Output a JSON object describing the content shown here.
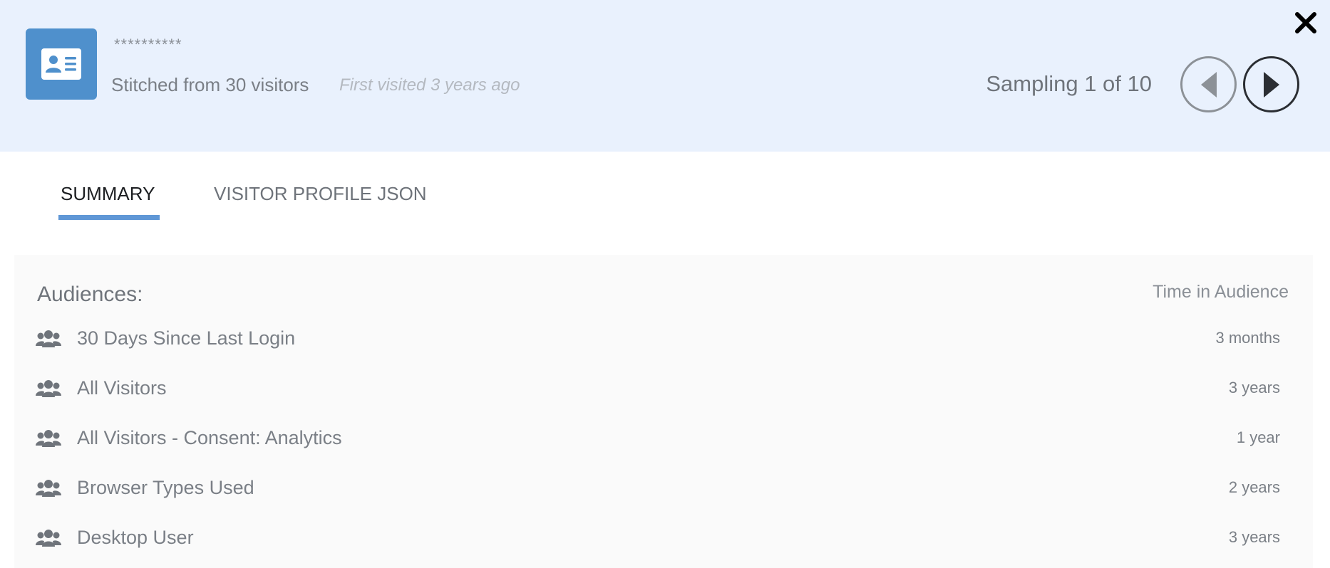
{
  "header": {
    "visitor_id": "**********",
    "stitched_text": "Stitched from 30 visitors",
    "first_visited_text": "First visited 3 years ago",
    "sampling_text": "Sampling 1 of 10",
    "icons": {
      "avatar": "id-card-icon",
      "prev": "triangle-left-icon",
      "next": "triangle-right-icon",
      "close": "close-icon"
    }
  },
  "tabs": [
    {
      "label": "SUMMARY",
      "active": true
    },
    {
      "label": "VISITOR PROFILE JSON",
      "active": false
    }
  ],
  "audiences": {
    "title": "Audiences:",
    "time_header": "Time in Audience",
    "icon": "group-icon",
    "items": [
      {
        "label": "30 Days Since Last Login",
        "time": "3 months"
      },
      {
        "label": "All Visitors",
        "time": "3 years"
      },
      {
        "label": "All Visitors - Consent: Analytics",
        "time": "1 year"
      },
      {
        "label": "Browser Types Used",
        "time": "2 years"
      },
      {
        "label": "Desktop User",
        "time": "3 years"
      }
    ]
  },
  "colors": {
    "header_bg": "#e9f1fd",
    "accent": "#5f97d6",
    "avatar_bg": "#4f90cc",
    "panel_bg": "#fafafa",
    "text_muted": "#7a7f86"
  }
}
